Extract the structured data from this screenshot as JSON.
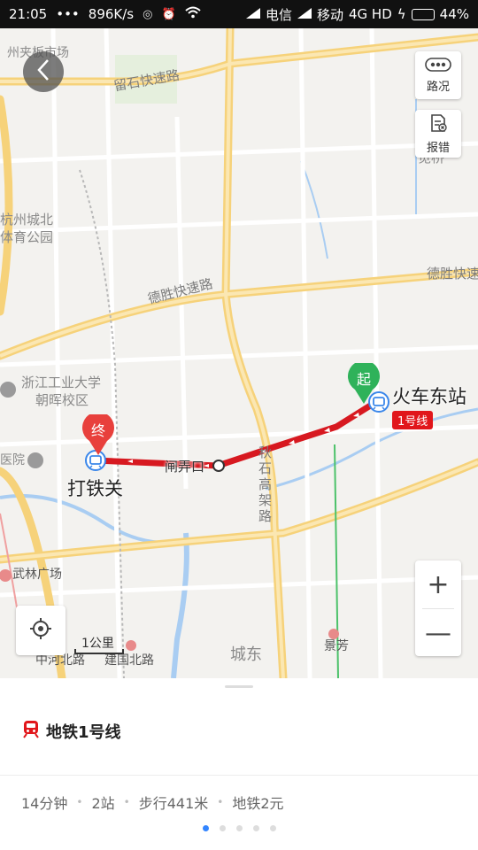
{
  "status_bar": {
    "time": "21:05",
    "dots": "•••",
    "net_speed": "896K/s",
    "carrier1": "电信",
    "carrier2": "移动",
    "network": "4G HD",
    "battery": "44%",
    "battery_level": 0.44
  },
  "map": {
    "back_icon": "chevron-left-icon",
    "traffic_label": "路况",
    "report_label": "报错",
    "zoom_in": "+",
    "zoom_out": "—",
    "scale": "1公里",
    "places": {
      "hangzhou_market": "州夹板市场",
      "sports_park_1": "杭州城北",
      "sports_park_2": "体育公园",
      "zjut_1": "浙江工业大学",
      "zjut_2": "朝晖校区",
      "hospital": "医院",
      "wulin": "武林广场",
      "zhonghe": "中河北路",
      "jianguo": "建国北路",
      "chengdong": "城东",
      "jingfang": "景芳",
      "bingyi": "笕桥"
    },
    "roads": {
      "liushi": "留石快速路",
      "desheng1": "德胜快速路",
      "desheng2": "德胜快速",
      "qiushi": "秋石高架路"
    },
    "stations": {
      "start_pin": "起",
      "end_pin": "终",
      "start_name": "火车东站",
      "end_name": "打铁关",
      "middle_name": "闸弄口",
      "line_badge": "1号线"
    },
    "colors": {
      "route": "#d71920",
      "start_pin": "#2fb25a",
      "end_pin": "#e8403c",
      "expressway": "#f7d57a"
    }
  },
  "sheet": {
    "route_name": "地铁1号线",
    "duration": "14分钟",
    "stops": "2站",
    "walk": "步行441米",
    "fare": "地铁2元",
    "pages": 5,
    "active_page": 0
  }
}
